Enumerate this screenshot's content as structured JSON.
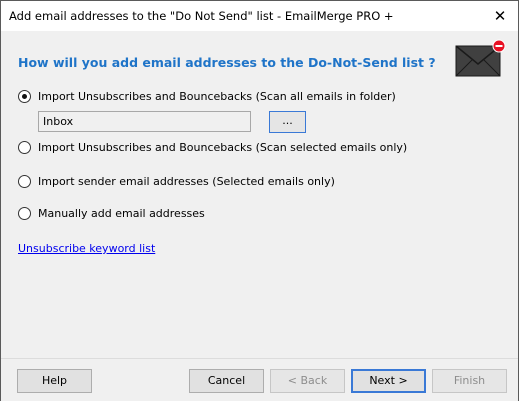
{
  "window": {
    "title": "Add email addresses to the \"Do Not Send\" list - EmailMerge PRO +",
    "close_glyph": "✕"
  },
  "main": {
    "heading": "How will you add email addresses to the Do-Not-Send list ?",
    "icon": "envelope-remove-icon",
    "options": [
      {
        "label": "Import Unsubscribes and Bouncebacks (Scan all emails in folder)",
        "selected": true
      },
      {
        "label": "Import Unsubscribes and Bouncebacks (Scan selected emails only)",
        "selected": false
      },
      {
        "label": "Import sender email addresses (Selected emails only)",
        "selected": false
      },
      {
        "label": "Manually add email addresses",
        "selected": false
      }
    ],
    "folder": {
      "value": "Inbox",
      "browse_label": "..."
    },
    "link_label": "Unsubscribe keyword list"
  },
  "footer": {
    "help_label": "Help",
    "cancel_label": "Cancel",
    "back_label": "< Back",
    "next_label": "Next >",
    "finish_label": "Finish"
  },
  "colors": {
    "heading": "#1f74c8",
    "link": "#0000ee",
    "accent_border": "#3a79d6",
    "badge_red": "#e81123"
  }
}
